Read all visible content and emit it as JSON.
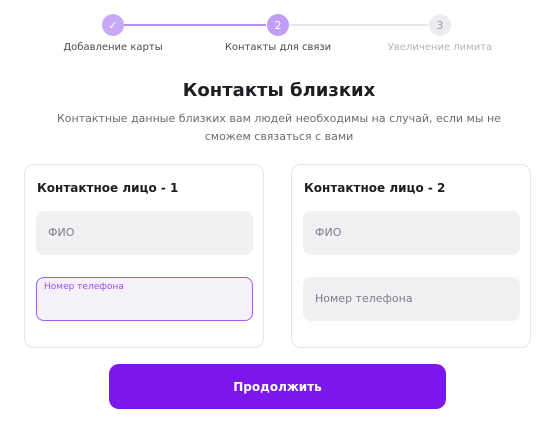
{
  "stepper": {
    "steps": [
      {
        "marker": "✓",
        "label": "Добавление карты",
        "state": "completed"
      },
      {
        "marker": "2",
        "label": "Контакты для связи",
        "state": "current"
      },
      {
        "marker": "3",
        "label": "Увеличение лимита",
        "state": "upcoming"
      }
    ]
  },
  "header": {
    "title": "Контакты близких",
    "subtitle": "Контактные данные близких вам людей необходимы на случай, если мы не сможем связаться с вами"
  },
  "contacts": [
    {
      "title": "Контактное лицо - 1",
      "name_field": {
        "placeholder": "ФИО",
        "value": ""
      },
      "phone_field": {
        "label": "Номер телефона",
        "value": "",
        "focused": true
      }
    },
    {
      "title": "Контактное лицо - 2",
      "name_field": {
        "placeholder": "ФИО",
        "value": ""
      },
      "phone_field": {
        "placeholder": "Номер телефона",
        "value": "",
        "focused": false
      }
    }
  ],
  "actions": {
    "continue_label": "Продолжить"
  },
  "colors": {
    "accent": "#7b17ea",
    "step_done": "#c9a8f5",
    "step_inactive": "#ececf0",
    "field_background": "#f1f1f4",
    "focused_border": "#a35df0"
  }
}
